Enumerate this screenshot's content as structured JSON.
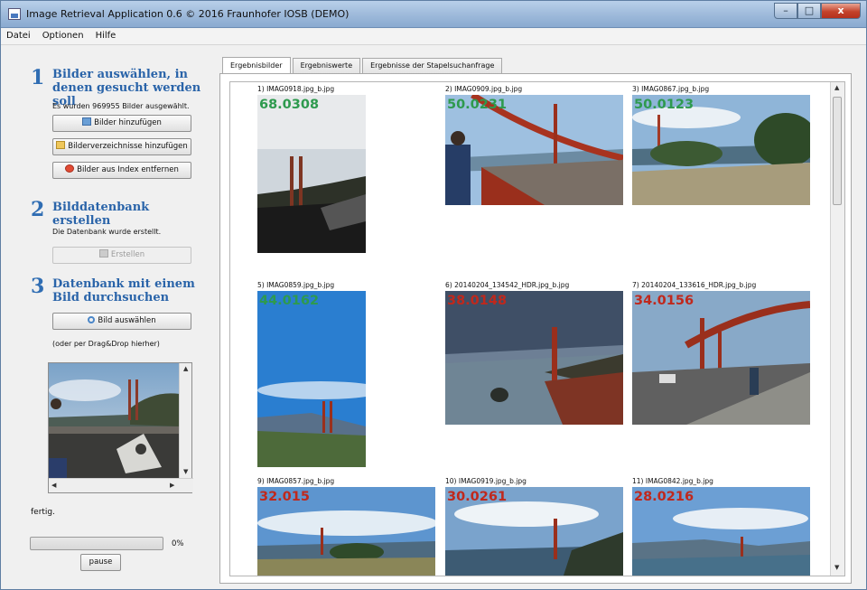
{
  "window": {
    "title": "Image Retrieval Application 0.6 © 2016 Fraunhofer IOSB (DEMO)",
    "controls": [
      "–",
      "□",
      "x"
    ]
  },
  "menu": [
    "Datei",
    "Optionen",
    "Hilfe"
  ],
  "steps": [
    {
      "number": "1",
      "title": "Bilder auswählen, in denen gesucht werden soll",
      "info": "Es wurden 969955 Bilder ausgewählt."
    },
    {
      "number": "2",
      "title": "Bilddatenbank erstellen",
      "info": "Die Datenbank wurde erstellt."
    },
    {
      "number": "3",
      "title": "Datenbank mit einem Bild durchsuchen",
      "info": "(oder per Drag&Drop hierher)"
    }
  ],
  "buttons": {
    "add_images": "Bilder hinzufügen",
    "add_folders": "Bilderverzeichnisse hinzufügen",
    "remove_images": "Bilder aus Index entfernen",
    "create": "Erstellen",
    "select_image": "Bild auswählen",
    "pause": "pause"
  },
  "status": {
    "text": "fertig.",
    "progress_label": "0%",
    "progress_fraction": 0
  },
  "tabs": [
    "Ergebnisbilder",
    "Ergebniswerte",
    "Ergebnisse der Stapelsuchanfrage"
  ],
  "results": [
    {
      "label": "1) IMAG0918.jpg_b.jpg",
      "score": "68.0308",
      "color": "#2e9a4e"
    },
    {
      "label": "2) IMAG0909.jpg_b.jpg",
      "score": "50.0231",
      "color": "#2e9a4e"
    },
    {
      "label": "3) IMAG0867.jpg_b.jpg",
      "score": "50.0123",
      "color": "#2e9a4e"
    },
    {
      "label": "5) IMAG0859.jpg_b.jpg",
      "score": "44.0162",
      "color": "#2e9a4e"
    },
    {
      "label": "6) 20140204_134542_HDR.jpg_b.jpg",
      "score": "38.0148",
      "color": "#c0281c"
    },
    {
      "label": "7) 20140204_133616_HDR.jpg_b.jpg",
      "score": "34.0156",
      "color": "#c0281c"
    },
    {
      "label": "9) IMAG0857.jpg_b.jpg",
      "score": "32.015",
      "color": "#c0281c"
    },
    {
      "label": "10) IMAG0919.jpg_b.jpg",
      "score": "30.0261",
      "color": "#c0281c"
    },
    {
      "label": "11) IMAG0842.jpg_b.jpg",
      "score": "28.0216",
      "color": "#c0281c"
    }
  ]
}
